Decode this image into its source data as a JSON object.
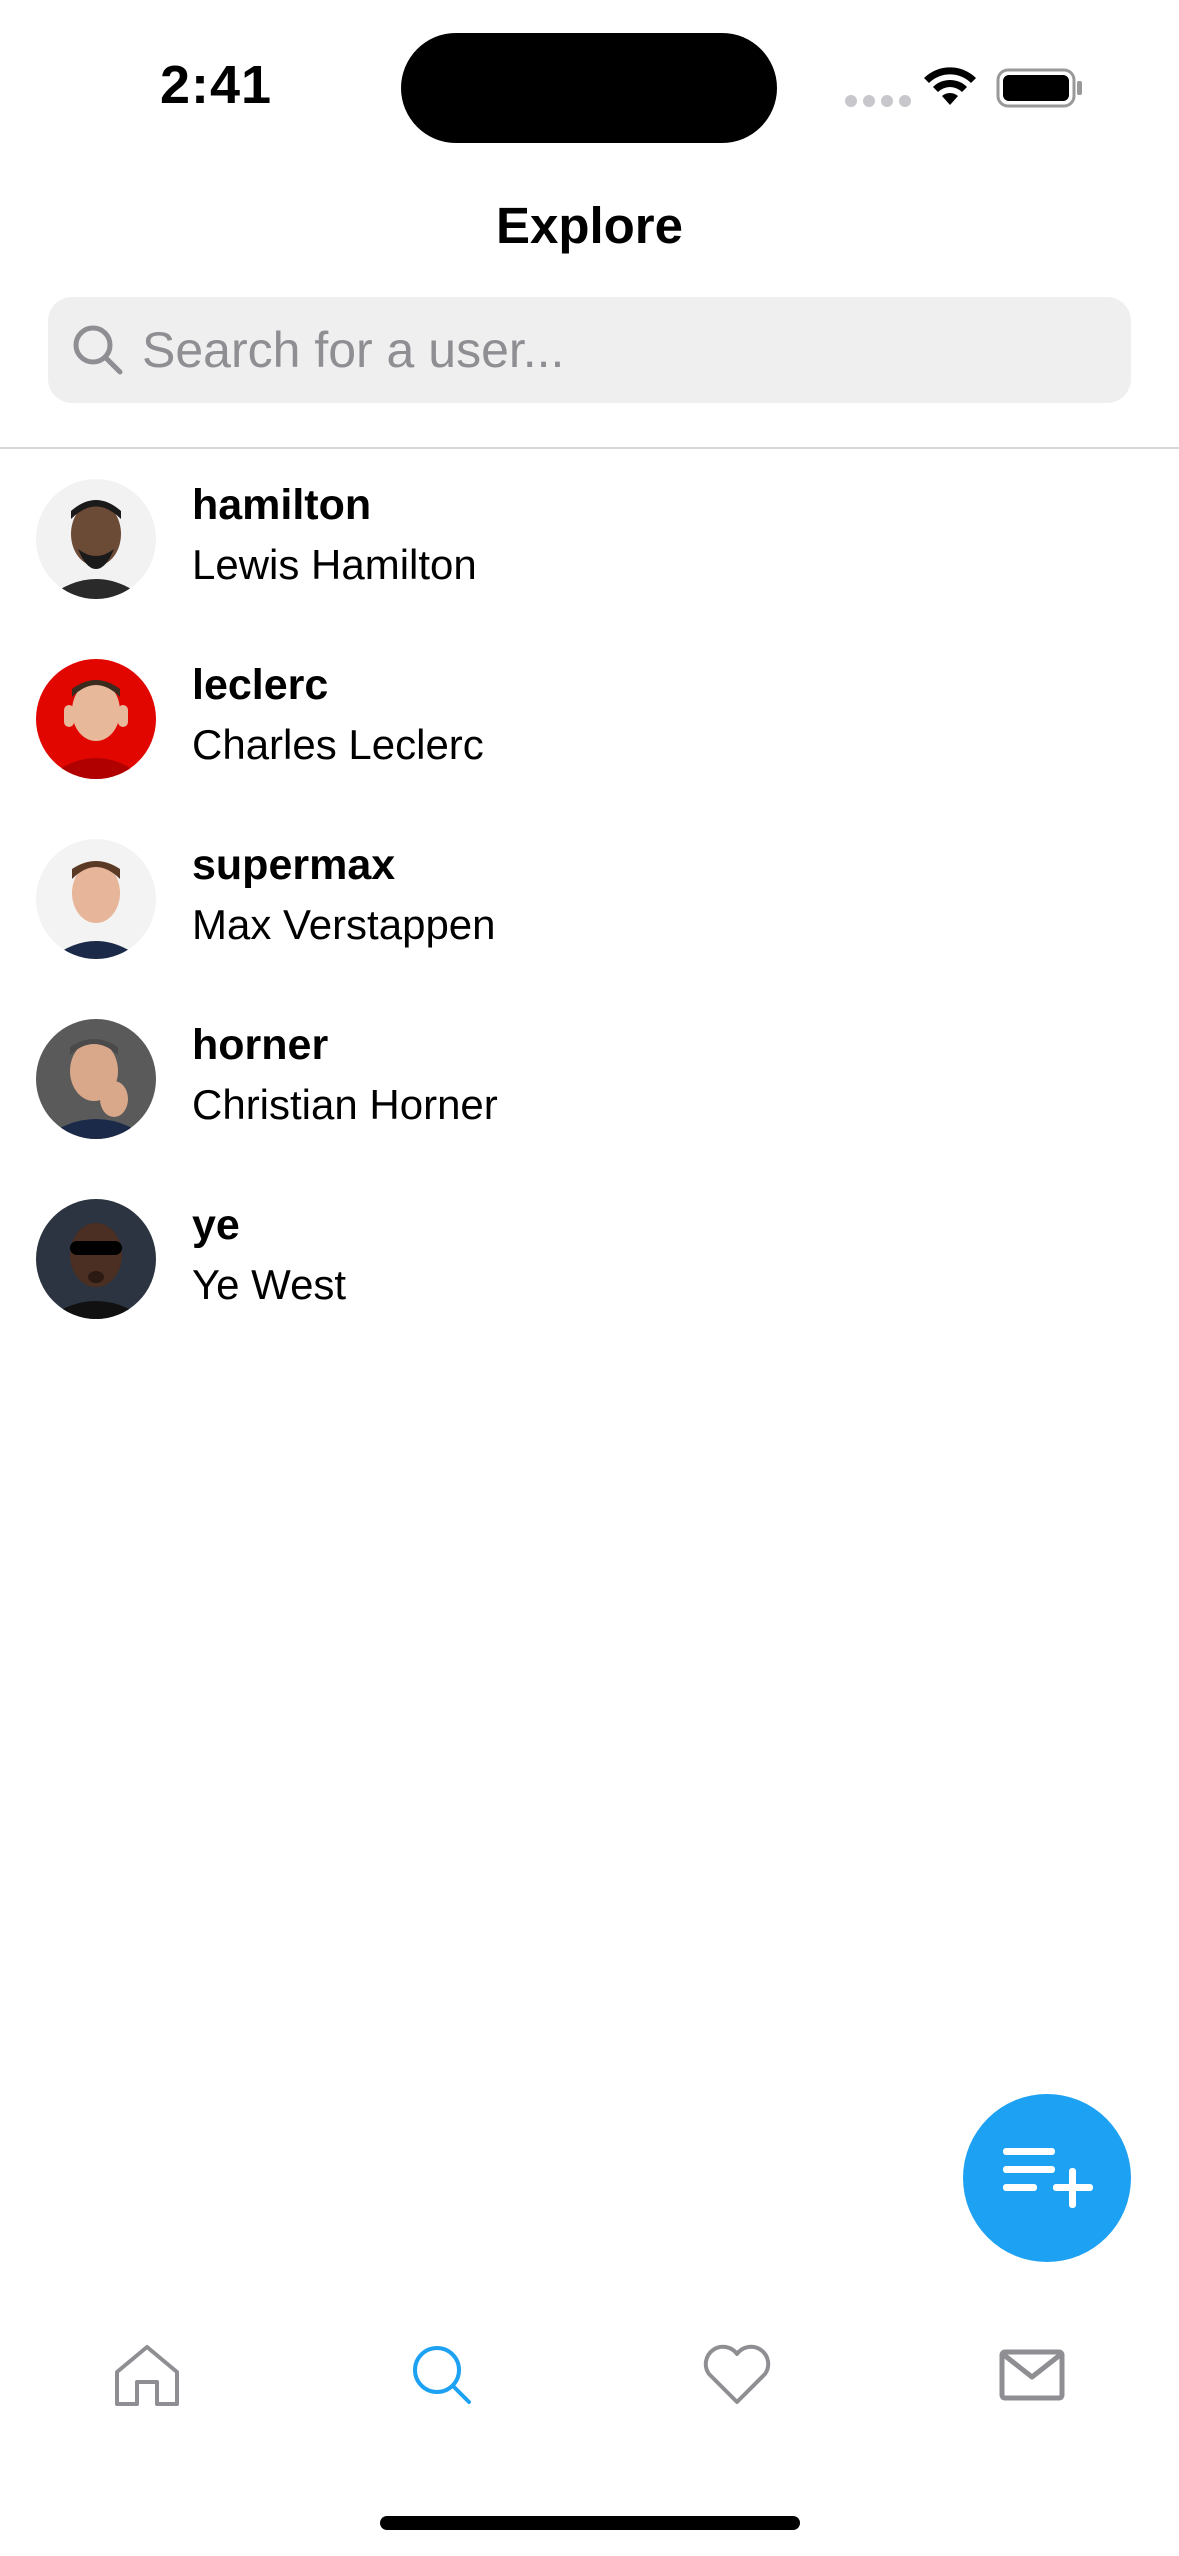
{
  "status_bar": {
    "time": "2:41"
  },
  "header": {
    "title": "Explore"
  },
  "search": {
    "placeholder": "Search for a user..."
  },
  "users": [
    {
      "username": "hamilton",
      "fullname": "Lewis Hamilton",
      "avatar_bg": "#3a3a3a"
    },
    {
      "username": "leclerc",
      "fullname": "Charles Leclerc",
      "avatar_bg": "#e10600"
    },
    {
      "username": "supermax",
      "fullname": "Max Verstappen",
      "avatar_bg": "#eeeeee"
    },
    {
      "username": "horner",
      "fullname": "Christian Horner",
      "avatar_bg": "#4a4a4a"
    },
    {
      "username": "ye",
      "fullname": "Ye West",
      "avatar_bg": "#2b3440"
    }
  ],
  "fab": {
    "icon": "new-post-icon",
    "color": "#1da1f2"
  },
  "tab_bar": {
    "tabs": [
      {
        "name": "home",
        "icon": "home-icon",
        "active": false
      },
      {
        "name": "explore",
        "icon": "search-icon",
        "active": true
      },
      {
        "name": "likes",
        "icon": "heart-icon",
        "active": false
      },
      {
        "name": "messages",
        "icon": "mail-icon",
        "active": false
      }
    ],
    "active_color": "#1da1f2",
    "inactive_color": "#8e8e93"
  }
}
